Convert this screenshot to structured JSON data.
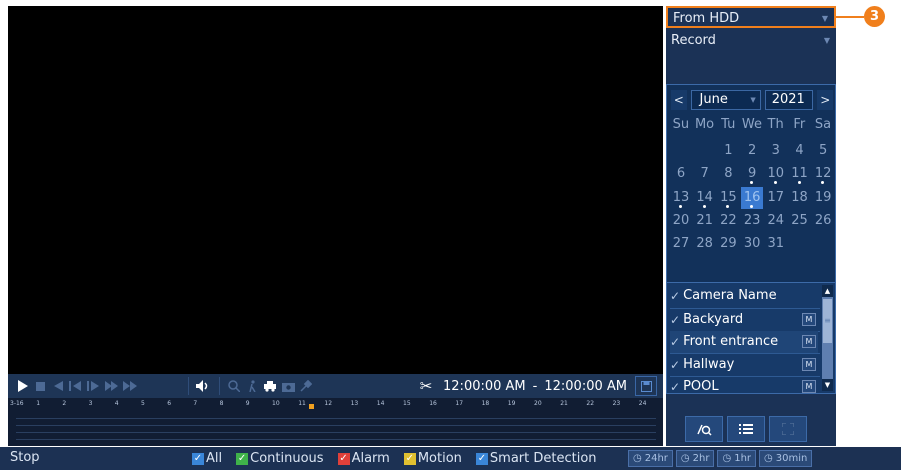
{
  "controls": {
    "play_icon": "play-icon",
    "stop_icon": "stop-icon",
    "rewind_icon": "rewind-icon",
    "step_back_icon": "step-back-icon",
    "step_forward_icon": "step-forward-icon",
    "fast_forward_icon": "fast-forward-icon",
    "volume_icon": "volume-icon",
    "zoom_icon": "zoom-icon",
    "person_icon": "person-icon",
    "vehicle_icon": "vehicle-icon",
    "snapshot_icon": "snapshot-icon",
    "pin_icon": "pin-icon",
    "clip_icon": "scissors-icon",
    "time_start": "12:00:00 AM",
    "time_separator": "-",
    "time_end": "12:00:00 AM",
    "save_icon": "save-icon"
  },
  "timeline": {
    "date_label": "3-16",
    "hours": [
      "1",
      "2",
      "3",
      "4",
      "5",
      "6",
      "7",
      "8",
      "9",
      "10",
      "11",
      "12",
      "13",
      "14",
      "15",
      "16",
      "17",
      "18",
      "19",
      "20",
      "21",
      "22",
      "23",
      "24"
    ],
    "cursor_hour": 11.5
  },
  "status": {
    "state": "Stop",
    "legend": [
      {
        "label": "All",
        "color": "#3a86d8"
      },
      {
        "label": "Continuous",
        "color": "#3fb24a"
      },
      {
        "label": "Alarm",
        "color": "#e0403a"
      },
      {
        "label": "Motion",
        "color": "#e0c030"
      },
      {
        "label": "Smart Detection",
        "color": "#3a86d8"
      }
    ],
    "time_ranges": [
      "24hr",
      "2hr",
      "1hr",
      "30min"
    ]
  },
  "panel": {
    "source": "From HDD",
    "record_type": "Record",
    "callout_number": "3",
    "calendar": {
      "prev": "<",
      "month": "June",
      "year": "2021",
      "next": ">",
      "weekdays": [
        "Su",
        "Mo",
        "Tu",
        "We",
        "Th",
        "Fr",
        "Sa"
      ],
      "first_weekday": 2,
      "days_in_month": 31,
      "selected_day": 16,
      "record_days": [
        9,
        10,
        11,
        12,
        13,
        14,
        15,
        16
      ]
    },
    "camera_header": "Camera Name",
    "cameras": [
      {
        "name": "Backyard",
        "mode": "M"
      },
      {
        "name": "Front entrance",
        "mode": "M"
      },
      {
        "name": "Hallway",
        "mode": "M"
      },
      {
        "name": "POOL",
        "mode": "M"
      }
    ],
    "buttons": [
      "smart-search-icon",
      "list-icon",
      "fullscreen-icon"
    ]
  }
}
